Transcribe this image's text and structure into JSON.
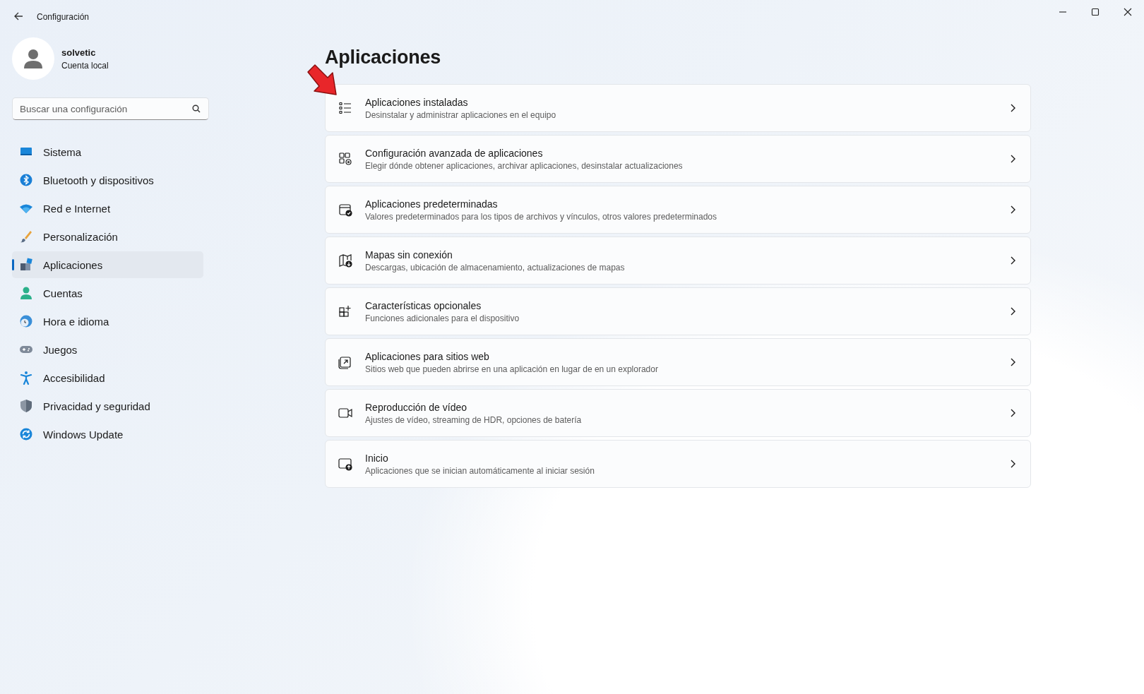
{
  "window": {
    "title": "Configuración"
  },
  "account": {
    "name": "solvetic",
    "type": "Cuenta local"
  },
  "search": {
    "placeholder": "Buscar una configuración"
  },
  "sidebar": {
    "items": [
      {
        "label": "Sistema",
        "selected": false
      },
      {
        "label": "Bluetooth y dispositivos",
        "selected": false
      },
      {
        "label": "Red e Internet",
        "selected": false
      },
      {
        "label": "Personalización",
        "selected": false
      },
      {
        "label": "Aplicaciones",
        "selected": true
      },
      {
        "label": "Cuentas",
        "selected": false
      },
      {
        "label": "Hora e idioma",
        "selected": false
      },
      {
        "label": "Juegos",
        "selected": false
      },
      {
        "label": "Accesibilidad",
        "selected": false
      },
      {
        "label": "Privacidad y seguridad",
        "selected": false
      },
      {
        "label": "Windows Update",
        "selected": false
      }
    ]
  },
  "page": {
    "title": "Aplicaciones"
  },
  "cards": [
    {
      "title": "Aplicaciones instaladas",
      "subtitle": "Desinstalar y administrar aplicaciones en el equipo"
    },
    {
      "title": "Configuración avanzada de aplicaciones",
      "subtitle": "Elegir dónde obtener aplicaciones, archivar aplicaciones, desinstalar actualizaciones"
    },
    {
      "title": "Aplicaciones predeterminadas",
      "subtitle": "Valores predeterminados para los tipos de archivos y vínculos, otros valores predeterminados"
    },
    {
      "title": "Mapas sin conexión",
      "subtitle": "Descargas, ubicación de almacenamiento, actualizaciones de mapas"
    },
    {
      "title": "Características opcionales",
      "subtitle": "Funciones adicionales para el dispositivo"
    },
    {
      "title": "Aplicaciones para sitios web",
      "subtitle": "Sitios web que pueden abrirse en una aplicación en lugar de en un explorador"
    },
    {
      "title": "Reproducción de vídeo",
      "subtitle": "Ajustes de vídeo, streaming de HDR, opciones de batería"
    },
    {
      "title": "Inicio",
      "subtitle": "Aplicaciones que se inician automáticamente al iniciar sesión"
    }
  ]
}
